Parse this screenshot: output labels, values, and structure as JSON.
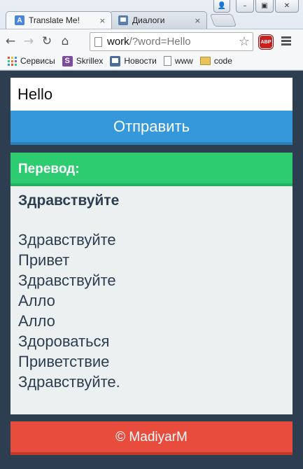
{
  "browser": {
    "tabs": [
      {
        "label": "Translate Me!",
        "close": "×",
        "active": true
      },
      {
        "label": "Диалоги",
        "close": "×",
        "active": false
      }
    ],
    "url_host": "work",
    "url_path": "/?word=Hello",
    "abp_label": "ABP",
    "bookmarks": [
      {
        "label": "Сервисы",
        "icon": "apps-icon"
      },
      {
        "label": "Skrillex",
        "icon": "skrillex-icon"
      },
      {
        "label": "Новости",
        "icon": "news-icon"
      },
      {
        "label": "www",
        "icon": "page-icon"
      },
      {
        "label": "code",
        "icon": "folder-icon"
      }
    ]
  },
  "form": {
    "word_value": "Hello",
    "submit_label": "Отправить"
  },
  "result": {
    "header": "Перевод:",
    "main": "Здравствуйте",
    "variants": [
      "Здравствуйте",
      "Привет",
      "Здравствуйте",
      "Алло",
      "Алло",
      "Здороваться",
      "Приветствие",
      "Здравствуйте."
    ]
  },
  "footer": {
    "text": "© MadiyarM"
  },
  "colors": {
    "page_bg": "#2c3e50",
    "submit": "#3498db",
    "header": "#2ecc71",
    "footer": "#e74c3c",
    "result_bg": "#ecf0f1"
  }
}
